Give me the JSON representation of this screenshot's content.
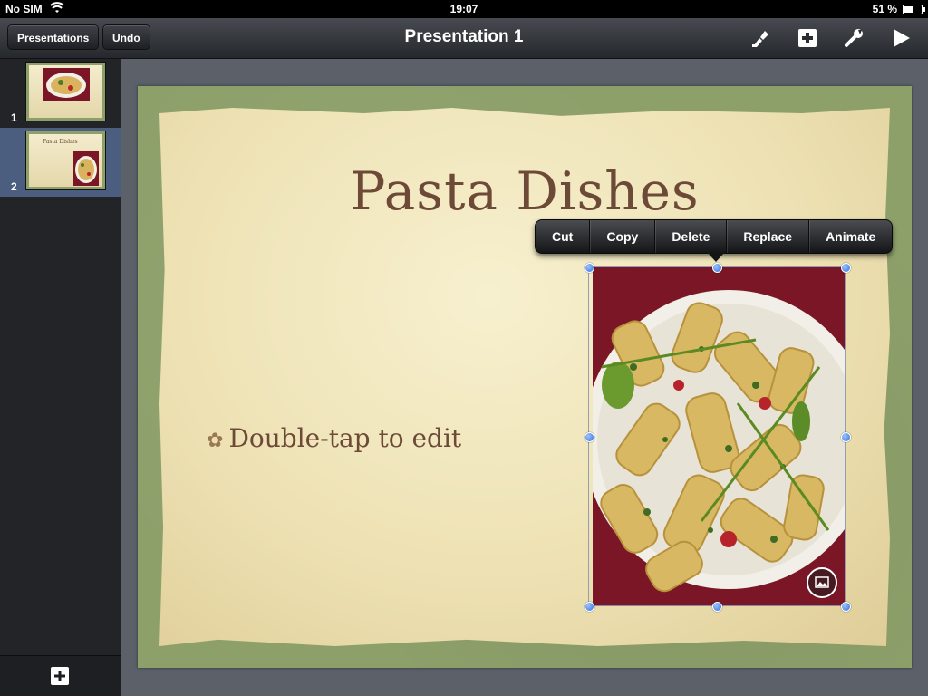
{
  "status_bar": {
    "carrier": "No SIM",
    "time": "19:07",
    "battery": "51 %",
    "battery_level": 0.51
  },
  "toolbar": {
    "presentations_label": "Presentations",
    "undo_label": "Undo",
    "title": "Presentation 1",
    "icons": [
      "paintbrush-icon",
      "plus-icon",
      "wrench-icon",
      "play-icon"
    ]
  },
  "sidebar": {
    "slides": [
      {
        "number": "1",
        "selected": false
      },
      {
        "number": "2",
        "selected": true,
        "title": "Pasta Dishes"
      }
    ]
  },
  "slide": {
    "title": "Pasta Dishes",
    "bullet": "Double-tap to edit"
  },
  "context_menu": {
    "items": [
      "Cut",
      "Copy",
      "Delete",
      "Replace",
      "Animate"
    ]
  },
  "colors": {
    "selection_handle": "#2d6fdc",
    "slide_frame": "#8da06a",
    "title_text": "#6d4a38"
  }
}
